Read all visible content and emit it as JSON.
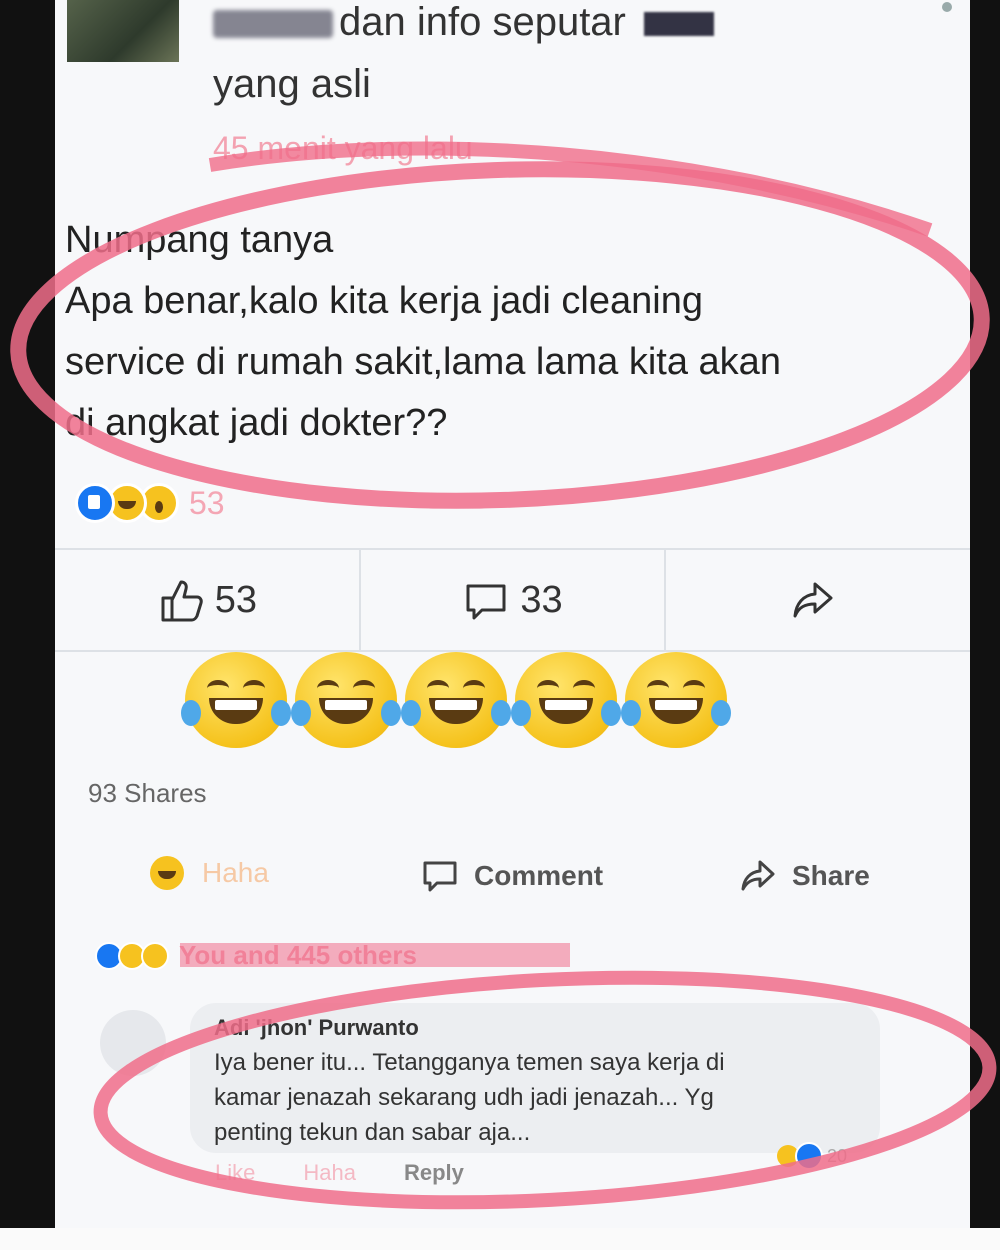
{
  "header": {
    "line1_suffix": "dan info seputar",
    "line2": "yang asli",
    "timestamp": "45 menit yang lalu"
  },
  "post": {
    "lines": [
      "Numpang tanya",
      "Apa benar,kalo kita kerja jadi cleaning",
      "service di rumah sakit,lama lama kita akan",
      "di angkat jadi dokter??"
    ],
    "reaction_count": "53"
  },
  "action_bar": {
    "like_count": "53",
    "comment_count": "33"
  },
  "emoji_icons": [
    "tears-of-joy-emoji",
    "tears-of-joy-emoji",
    "tears-of-joy-emoji",
    "tears-of-joy-emoji",
    "tears-of-joy-emoji"
  ],
  "shares": "93 Shares",
  "bottom_actions": {
    "haha": "Haha",
    "comment": "Comment",
    "share": "Share"
  },
  "reaction_summary": "You and 445 others",
  "comment": {
    "author": "Adi 'jhon' Purwanto",
    "body_lines": [
      "Iya bener itu... Tetangganya temen saya kerja di",
      "kamar jenazah sekarang udh jadi jenazah... Yg",
      "penting tekun dan sabar aja..."
    ],
    "reaction_count": "20",
    "like_label": "Like",
    "haha_label": "Haha",
    "reply_label": "Reply"
  },
  "colors": {
    "annotation_circle": "#f06d8a",
    "facebook_blue": "#1877f2",
    "haha_yellow": "#f6c21f"
  }
}
